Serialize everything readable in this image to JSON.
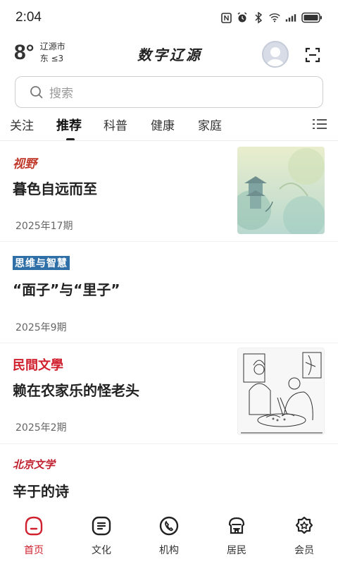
{
  "status_bar": {
    "time": "2:04",
    "icons": [
      "nfc-icon",
      "alarm-icon",
      "bluetooth-icon",
      "wifi-icon",
      "signal-icon",
      "battery-icon"
    ]
  },
  "header": {
    "temperature": "8°",
    "city": "辽源市",
    "wind": "东  ≤3",
    "logo": "数字辽源"
  },
  "search": {
    "placeholder": "搜索"
  },
  "tabs": [
    {
      "label": "关注"
    },
    {
      "label": "推荐"
    },
    {
      "label": "科普"
    },
    {
      "label": "健康"
    },
    {
      "label": "家庭"
    }
  ],
  "articles": [
    {
      "source": "视野",
      "title": "暮色自远而至",
      "issue": "2025年17期"
    },
    {
      "source": "思维与智慧",
      "title": "“面子”与“里子”",
      "issue": "2025年9期"
    },
    {
      "source": "民間文學",
      "title": "赖在农家乐的怪老头",
      "issue": "2025年2期"
    },
    {
      "source": "北京文学",
      "title": "辛于的诗",
      "issue": ""
    }
  ],
  "bottom_nav": [
    {
      "label": "首页"
    },
    {
      "label": "文化"
    },
    {
      "label": "机构"
    },
    {
      "label": "居民"
    },
    {
      "label": "会员"
    }
  ],
  "colors": {
    "accent": "#d0202e",
    "text": "#222222",
    "muted": "#666666"
  }
}
